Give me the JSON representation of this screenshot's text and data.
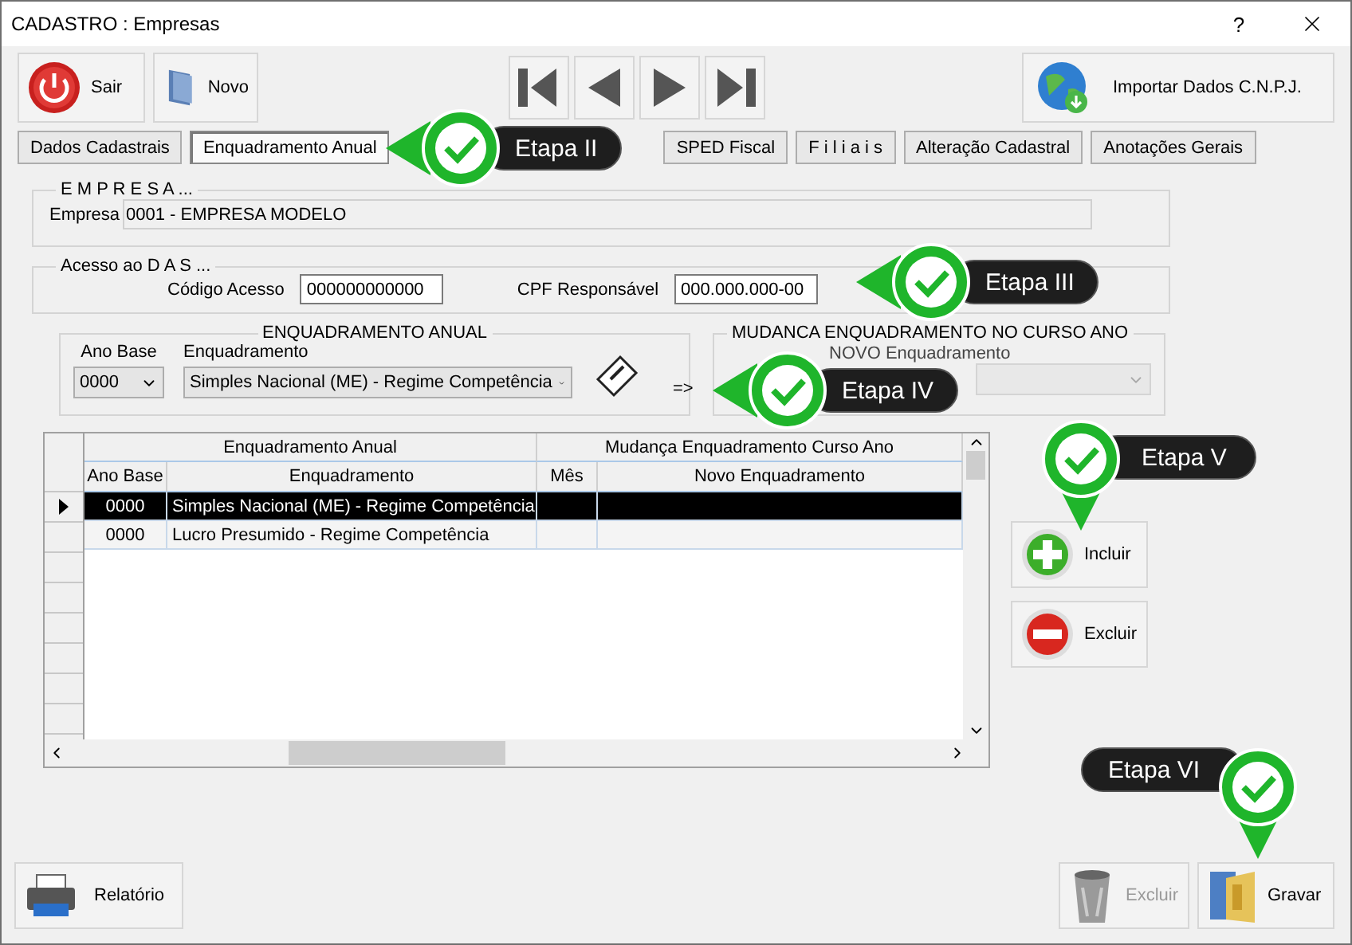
{
  "window": {
    "title": "CADASTRO : Empresas",
    "help": "?"
  },
  "toolbar": {
    "buttons": [
      {
        "label": "Sair",
        "kind": "power"
      },
      {
        "label": "Novo",
        "kind": "doc"
      }
    ],
    "import_label": "Importar Dados C.N.P.J."
  },
  "tabs": [
    {
      "label": "Dados Cadastrais",
      "selected": false
    },
    {
      "label": "Enquadramento Anual",
      "selected": true
    },
    {
      "label": "SPED Fiscal",
      "selected": false
    },
    {
      "label": "F i l i a i s",
      "selected": false
    },
    {
      "label": "Alteração Cadastral",
      "selected": false
    },
    {
      "label": "Anotações Gerais",
      "selected": false
    }
  ],
  "empresa": {
    "legend": "E M P R E S A ...",
    "label": "Empresa",
    "value": "0001 - EMPRESA MODELO"
  },
  "das": {
    "legend": "Acesso ao  D A S ...",
    "fields": [
      {
        "label": "Código Acesso",
        "value": "000000000000"
      },
      {
        "label": "CPF Responsável",
        "value": "000.000.000-00"
      }
    ]
  },
  "enquadramento": {
    "legend": "ENQUADRAMENTO   ANUAL",
    "ano_label": "Ano Base",
    "ano_value": "0000",
    "enq_label": "Enquadramento",
    "enq_value": "Simples Nacional (ME) - Regime Competência",
    "arrow": "=>"
  },
  "mudanca": {
    "legend": "MUDANCA  ENQUADRAMENTO  NO  CURSO  ANO",
    "novo_label": "NOVO  Enquadramento",
    "disabled": true
  },
  "grid": {
    "groups": [
      "Enquadramento Anual",
      "Mudança Enquadramento Curso Ano"
    ],
    "columns": [
      "Ano Base",
      "Enquadramento",
      "Mês",
      "Novo Enquadramento"
    ],
    "rows": [
      {
        "cells": [
          "0000",
          "Simples Nacional (ME) - Regime Competência",
          "",
          ""
        ],
        "selected": true
      },
      {
        "cells": [
          "0000",
          "Lucro Presumido - Regime Competência",
          "",
          ""
        ],
        "selected": false
      }
    ]
  },
  "side_buttons": [
    {
      "label": "Incluir",
      "kind": "plus"
    },
    {
      "label": "Excluir",
      "kind": "minus"
    }
  ],
  "bottom": {
    "report": "Relatório",
    "buttons": [
      {
        "label": "Excluir",
        "kind": "trash",
        "disabled": true
      },
      {
        "label": "Gravar",
        "kind": "save",
        "disabled": false
      }
    ]
  },
  "callouts": [
    {
      "label": "Etapa II",
      "kind": "left"
    },
    {
      "label": "Etapa III",
      "kind": "left"
    },
    {
      "label": "Etapa IV",
      "kind": "left"
    },
    {
      "label": "Etapa V",
      "kind": "down"
    },
    {
      "label": "Etapa VI",
      "kind": "down"
    }
  ]
}
